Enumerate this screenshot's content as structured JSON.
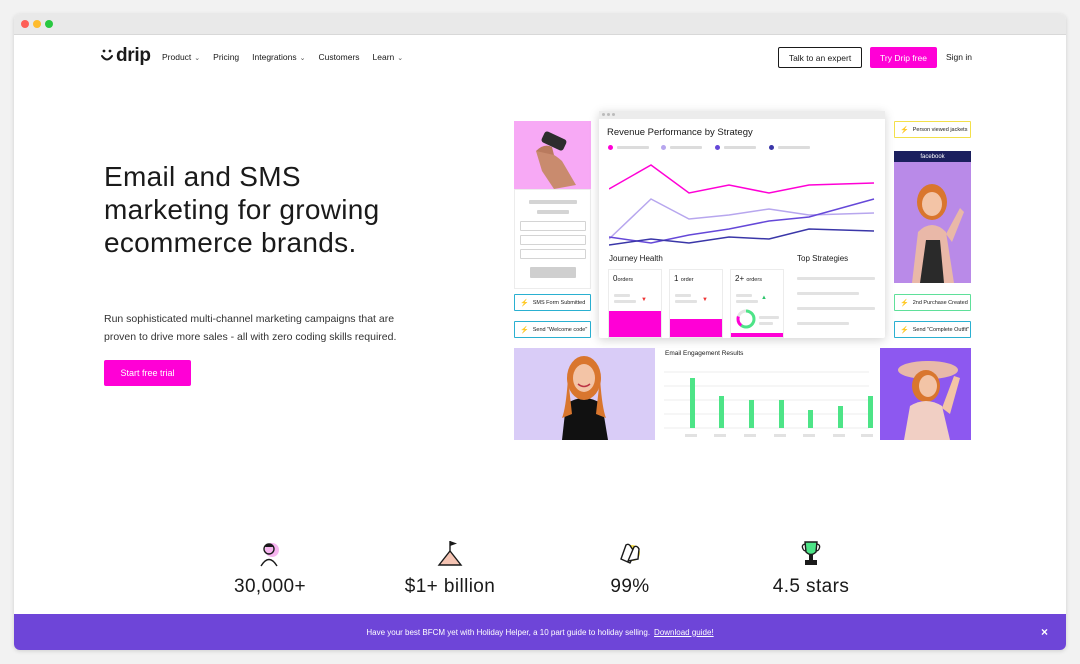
{
  "nav": {
    "logo": "drip",
    "menu": [
      {
        "label": "Product",
        "dropdown": true
      },
      {
        "label": "Pricing",
        "dropdown": false
      },
      {
        "label": "Integrations",
        "dropdown": true
      },
      {
        "label": "Customers",
        "dropdown": false
      },
      {
        "label": "Learn",
        "dropdown": true
      }
    ],
    "talk_label": "Talk to an expert",
    "try_label": "Try Drip free",
    "signin_label": "Sign in"
  },
  "hero": {
    "title": "Email and SMS marketing for growing ecommerce brands.",
    "subtitle": "Run sophisticated multi-channel marketing campaigns that are proven to drive more sales - all with zero coding skills required.",
    "cta_label": "Start free trial"
  },
  "dashboard": {
    "chart_title": "Revenue Performance by Strategy",
    "journey_title": "Journey Health",
    "top_title": "Top Strategies",
    "engagement_title": "Email Engagement Results",
    "journey_cols": [
      {
        "num": "0",
        "unit": "orders"
      },
      {
        "num": "1",
        "unit": "order"
      },
      {
        "num": "2+",
        "unit": "orders"
      }
    ],
    "tags": {
      "sms": "SMS Form Submitted",
      "welcome": "Send \"Welcome code\"",
      "viewed": "Person viewed jackets",
      "purchase": "2nd Purchase Created",
      "outfit": "Send \"Complete Outfit\""
    },
    "facebook": "facebook",
    "colors": {
      "magenta": "#ff00d6",
      "lavender": "#b7a6ee",
      "purple": "#6548d8",
      "navy": "#3a36a8",
      "green": "#4de487"
    }
  },
  "stats": [
    {
      "value": "30,000+",
      "label": ""
    },
    {
      "value": "$1+ billion",
      "label": ""
    },
    {
      "value": "99%",
      "label": ""
    },
    {
      "value": "4.5 stars",
      "label": ""
    }
  ],
  "banner": {
    "text": "Have your best BFCM yet with Holiday Helper, a 10 part guide to holiday selling.",
    "link": "Download guide!",
    "close": "×"
  }
}
